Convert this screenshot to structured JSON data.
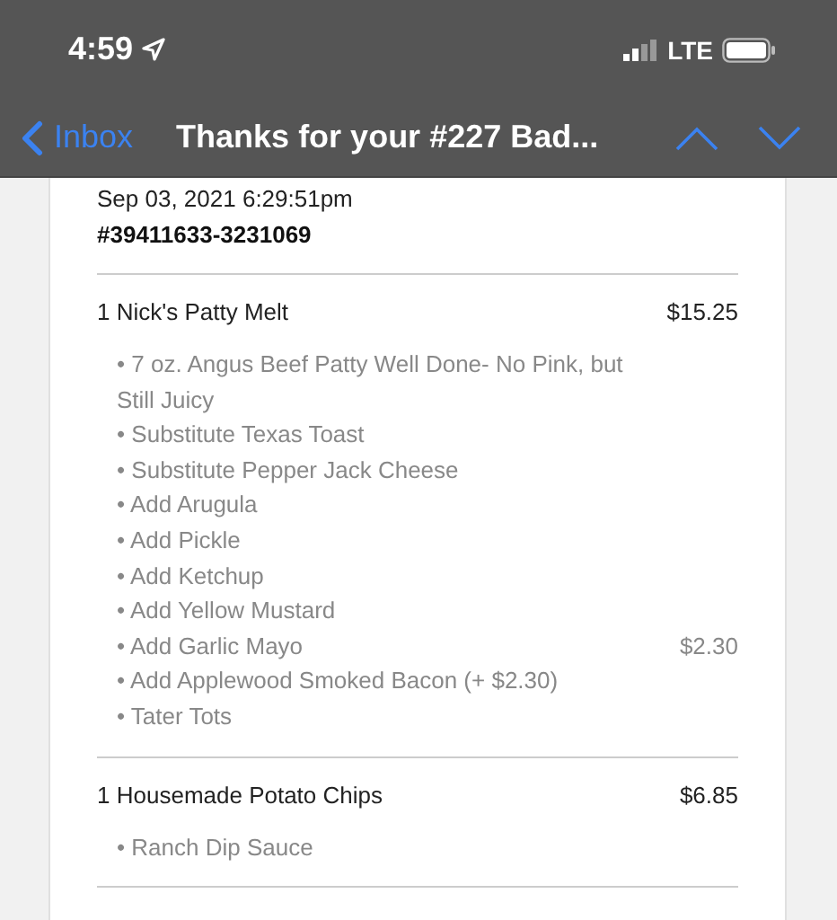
{
  "status_bar": {
    "time": "4:59",
    "network": "LTE"
  },
  "nav_bar": {
    "back": "Inbox",
    "title": "Thanks for your #227 Bad..."
  },
  "receipt": {
    "date": "Sep 03, 2021 6:29:51pm",
    "order_number": "#39411633-3231069",
    "items": [
      {
        "quantity": "1",
        "name": "Nick's Patty Melt",
        "price": "$15.25",
        "modifiers": [
          {
            "text": "• 7 oz. Angus Beef Patty Well Done- No Pink, but Still Juicy"
          },
          {
            "text": "• Substitute Texas Toast"
          },
          {
            "text": "• Substitute Pepper Jack Cheese"
          },
          {
            "text": "• Add Arugula"
          },
          {
            "text": "• Add Pickle"
          },
          {
            "text": "• Add Ketchup"
          },
          {
            "text": "• Add Yellow Mustard"
          },
          {
            "text": "• Add Garlic Mayo",
            "price": "$2.30"
          },
          {
            "text": "• Add Applewood Smoked Bacon (+ $2.30)"
          },
          {
            "text": "• Tater Tots"
          }
        ]
      },
      {
        "quantity": "1",
        "name": "Housemade Potato Chips",
        "price": "$6.85",
        "modifiers": [
          {
            "text": "• Ranch Dip Sauce"
          }
        ]
      }
    ]
  }
}
